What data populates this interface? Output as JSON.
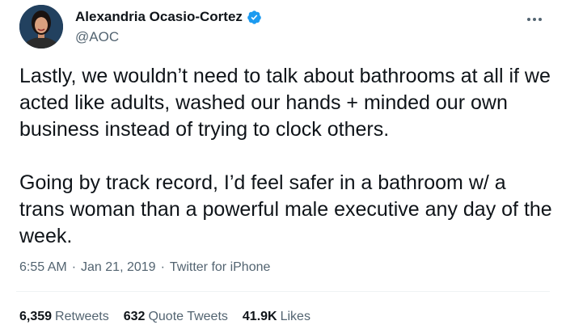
{
  "author": {
    "display_name": "Alexandria Ocasio-Cortez",
    "handle": "@AOC",
    "verified": true,
    "verified_color": "#1d9bf0"
  },
  "more_icon": "ellipsis-icon",
  "tweet": {
    "text": "Lastly, we wouldn’t need to talk about bathrooms at all if we acted like adults, washed our hands + minded our own business instead of trying to clock others.\n\nGoing by track record, I’d feel safer in a bathroom w/ a trans woman than a powerful male executive any day of the week."
  },
  "meta": {
    "time": "6:55 AM",
    "separator": "·",
    "date": "Jan 21, 2019",
    "source": "Twitter for iPhone"
  },
  "stats": {
    "retweets": {
      "count": "6,359",
      "label": "Retweets"
    },
    "quote_tweets": {
      "count": "632",
      "label": "Quote Tweets"
    },
    "likes": {
      "count": "41.9K",
      "label": "Likes"
    }
  },
  "colors": {
    "text_primary": "#0f1419",
    "text_secondary": "#536471"
  }
}
